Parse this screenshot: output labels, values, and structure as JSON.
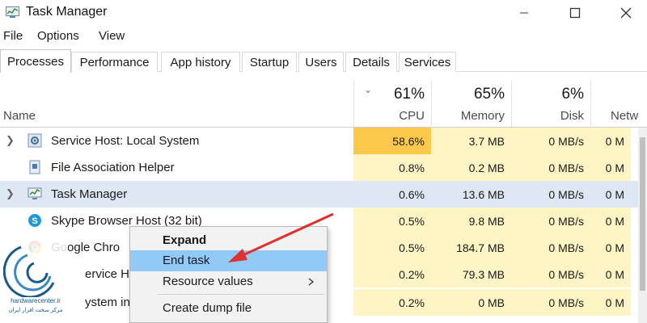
{
  "window": {
    "title": "Task Manager",
    "icons": {
      "app": "task-manager-icon",
      "minimize": "minimize-icon",
      "maximize": "maximize-icon",
      "close": "close-icon"
    }
  },
  "menu": {
    "file": "File",
    "options": "Options",
    "view": "View"
  },
  "tabs": [
    "Processes",
    "Performance",
    "App history",
    "Startup",
    "Users",
    "Details",
    "Services"
  ],
  "active_tab": "Processes",
  "columns": {
    "name": "Name",
    "cpu": {
      "pct": "61%",
      "label": "CPU"
    },
    "memory": {
      "pct": "65%",
      "label": "Memory"
    },
    "disk": {
      "pct": "6%",
      "label": "Disk"
    },
    "network": {
      "label": "Netwo"
    }
  },
  "rows": [
    {
      "name": "Service Host: Local System",
      "cpu": "58.6%",
      "memory": "3.7 MB",
      "disk": "0 MB/s",
      "network": "0 M",
      "expandable": true,
      "icon": "gear-icon"
    },
    {
      "name": "File Association Helper",
      "cpu": "0.8%",
      "memory": "0.2 MB",
      "disk": "0 MB/s",
      "network": "0 M",
      "expandable": false,
      "icon": "app-icon"
    },
    {
      "name": "Task Manager",
      "cpu": "0.6%",
      "memory": "13.6 MB",
      "disk": "0 MB/s",
      "network": "0 M",
      "expandable": true,
      "selected": true,
      "icon": "task-manager-icon"
    },
    {
      "name": "Skype Browser Host (32 bit)",
      "cpu": "0.5%",
      "memory": "9.8 MB",
      "disk": "0 MB/s",
      "network": "0 M",
      "expandable": false,
      "icon": "skype-icon"
    },
    {
      "name": "Google Chro",
      "cpu": "0.5%",
      "memory": "184.7 MB",
      "disk": "0 MB/s",
      "network": "0 M",
      "expandable": false,
      "icon": "chrome-icon"
    },
    {
      "name": "ervice Host",
      "cpu": "0.2%",
      "memory": "79.3 MB",
      "disk": "0 MB/s",
      "network": "0 M",
      "expandable": false,
      "icon": "gear-icon"
    },
    {
      "name": "ystem intern",
      "cpu": "0.2%",
      "memory": "0 MB",
      "disk": "0 MB/s",
      "network": "0 M",
      "expandable": false,
      "icon": "system-icon"
    }
  ],
  "context_menu": {
    "expand": "Expand",
    "end_task": "End task",
    "resource_values": "Resource values",
    "create_dump": "Create dump file"
  },
  "watermark": {
    "line1": "hardwarecenter.ir",
    "line2": "مرکز سخت افزار ایران"
  },
  "colors": {
    "cpu_high": "#fcc94a",
    "cpu_col": "#fff4c4",
    "mem_col": "#fff4c4",
    "selected_row": "#dde8f4",
    "menu_highlight": "#91c9f7",
    "arrow": "#e03030"
  }
}
